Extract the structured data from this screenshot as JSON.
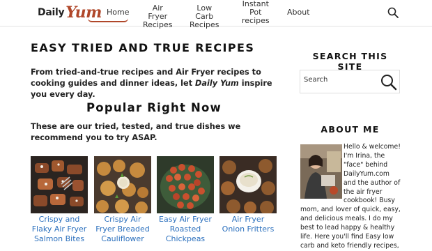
{
  "header": {
    "logo": {
      "word1": "Daily",
      "word2": "Yum"
    },
    "nav": [
      {
        "label": "Home"
      },
      {
        "label": "Air Fryer\nRecipes"
      },
      {
        "label": "Low Carb\nRecipes"
      },
      {
        "label": "Instant\nPot\nrecipes"
      },
      {
        "label": "About"
      }
    ],
    "search_icon": "search-icon"
  },
  "main": {
    "title": "EASY TRIED AND TRUE RECIPES",
    "intro_part1": "From tried-and-true recipes and Air Fryer recipes to cooking guides and dinner ideas, let ",
    "intro_em": "Daily Yum",
    "intro_part2": " inspire you every day.",
    "popular_title": "Popular Right Now",
    "popular_sub": "These are our tried, tested, and true dishes we recommend you to try ASAP.",
    "cards": [
      {
        "caption": "Crispy and Flaky Air Fryer Salmon Bites"
      },
      {
        "caption": "Crispy Air Fryer Breaded Cauliflower"
      },
      {
        "caption": "Easy Air Fryer Roasted Chickpeas"
      },
      {
        "caption": "Air Fryer Onion Fritters"
      }
    ]
  },
  "sidebar": {
    "search_title": "SEARCH THIS SITE",
    "search_placeholder": "Search",
    "about_title": "ABOUT ME",
    "about_text": "Hello & welcome! I'm Irina, the \"face\" behind DailyYum.com and the author of the air fryer cookbook! Busy mom, and lover of quick, easy, and delicious meals. I do my best to lead happy & healthy life. Here you'll find Easy low carb and keto friendly recipes,"
  },
  "colors": {
    "accent": "#b0472a",
    "link": "#2a6fbd"
  }
}
